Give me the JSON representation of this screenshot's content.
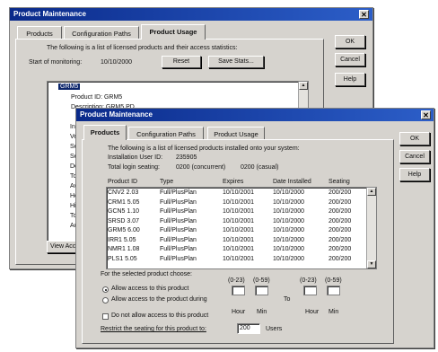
{
  "back_window": {
    "title": "Product Maintenance",
    "tabs": [
      "Products",
      "Configuration Paths",
      "Product Usage"
    ],
    "intro": "The following is a list of licensed products and their access statistics:",
    "start_label": "Start of monitoring:",
    "start_value": "10/10/2000",
    "reset_label": "Reset",
    "save_label": "Save Stats...",
    "tree_root": "GRM5",
    "product_id": "Product ID: GRM5",
    "desc_row": "Description: GRM5.PD",
    "clipped_rows": [
      "In",
      "Ve",
      "Se",
      "Se",
      "De",
      "To",
      "Av",
      "He",
      "Hi",
      "To",
      "Ac"
    ],
    "view_label": "View Acc",
    "ok": "OK",
    "cancel": "Cancel",
    "help": "Help"
  },
  "front_window": {
    "title": "Product Maintenance",
    "tabs": [
      "Products",
      "Configuration Paths",
      "Product Usage"
    ],
    "intro": "The following is a list of licensed products installed onto your system:",
    "install_user_label": "Installation User ID:",
    "install_user_value": "235905",
    "seating_label": "Total login seating:",
    "concurrent": "0200 (concurrent)",
    "casual": "0200 (casual)",
    "columns": [
      "Product ID",
      "Type",
      "Expires",
      "Date Installed",
      "Seating"
    ],
    "rows": [
      [
        "CNV2 2.03",
        "Full/PlusPlan",
        "10/10/2001",
        "10/10/2000",
        "200/200"
      ],
      [
        "CRM1 5.05",
        "Full/PlusPlan",
        "10/10/2001",
        "10/10/2000",
        "200/200"
      ],
      [
        "GCN5 1.10",
        "Full/PlusPlan",
        "10/10/2001",
        "10/10/2000",
        "200/200"
      ],
      [
        "SRSD 3.07",
        "Full/PlusPlan",
        "10/10/2001",
        "10/10/2000",
        "200/200"
      ],
      [
        "GRM5 6.00",
        "Full/PlusPlan",
        "10/10/2001",
        "10/10/2000",
        "200/200"
      ],
      [
        "IRR1 5.05",
        "Full/PlusPlan",
        "10/10/2001",
        "10/10/2000",
        "200/200"
      ],
      [
        "NMR1 1.08",
        "Full/PlusPlan",
        "10/10/2001",
        "10/10/2000",
        "200/200"
      ],
      [
        "PLS1 5.05",
        "Full/PlusPlan",
        "10/10/2001",
        "10/10/2000",
        "200/200"
      ]
    ],
    "choose_label": "For the selected product choose:",
    "range_a": "(0-23)",
    "range_b": "(0-59)",
    "range_c": "(0-23)",
    "range_d": "(0-59)",
    "opt_allow": "Allow access to this product",
    "opt_allow_during": "Allow access to the product during",
    "to_label": "To",
    "hour_label": "Hour",
    "min_label": "Min",
    "opt_dont": "Do not allow access to this product",
    "restrict_label": "Restrict the seating for this product to:",
    "restrict_value": "200",
    "users_label": "Users",
    "ok": "OK",
    "cancel": "Cancel",
    "help": "Help"
  }
}
